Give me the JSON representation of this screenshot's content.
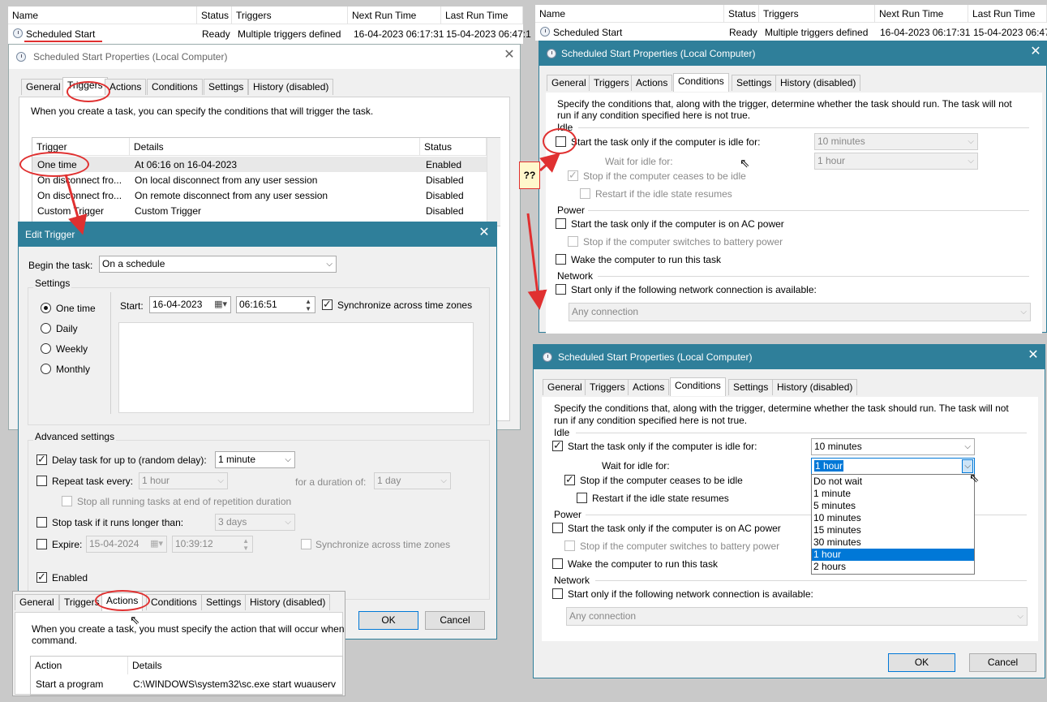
{
  "tasklist_header": {
    "name": "Name",
    "status": "Status",
    "triggers": "Triggers",
    "next_run": "Next Run Time",
    "last_run": "Last Run Time"
  },
  "task_row": {
    "name": "Scheduled Start",
    "status": "Ready",
    "triggers": "Multiple triggers defined",
    "next_run": "16-04-2023 06:17:31",
    "last_run_left": "15-04-2023 06:47:1",
    "last_run_right": "15-04-2023 06:47"
  },
  "props_title": "Scheduled Start Properties (Local Computer)",
  "tabs": [
    "General",
    "Triggers",
    "Actions",
    "Conditions",
    "Settings",
    "History (disabled)"
  ],
  "triggers_tab": {
    "intro": "When you create a task, you can specify the conditions that will trigger the task.",
    "columns": [
      "Trigger",
      "Details",
      "Status"
    ],
    "rows": [
      {
        "trigger": "One time",
        "details": "At 06:16 on 16-04-2023",
        "status": "Enabled"
      },
      {
        "trigger": "On disconnect fro...",
        "details": "On local disconnect from any user session",
        "status": "Disabled"
      },
      {
        "trigger": "On disconnect fro...",
        "details": "On remote disconnect from any user session",
        "status": "Disabled"
      },
      {
        "trigger": "Custom Trigger",
        "details": "Custom Trigger",
        "status": "Disabled"
      }
    ]
  },
  "edit_trigger": {
    "title": "Edit Trigger",
    "begin_label": "Begin the task:",
    "begin_value": "On a schedule",
    "settings_label": "Settings",
    "radios": [
      "One time",
      "Daily",
      "Weekly",
      "Monthly"
    ],
    "start_label": "Start:",
    "start_date": "16-04-2023",
    "start_time": "06:16:51",
    "sync_label": "Synchronize across time zones",
    "advanced_label": "Advanced settings",
    "delay_label": "Delay task for up to (random delay):",
    "delay_value": "1 minute",
    "repeat_label": "Repeat task every:",
    "repeat_value": "1 hour",
    "duration_label": "for a duration of:",
    "duration_value": "1 day",
    "stop_all_label": "Stop all running tasks at end of repetition duration",
    "stop_longer_label": "Stop task if it runs longer than:",
    "stop_longer_value": "3 days",
    "expire_label": "Expire:",
    "expire_date": "15-04-2024",
    "expire_time": "10:39:12",
    "expire_sync_label": "Synchronize across time zones",
    "enabled_label": "Enabled",
    "ok": "OK",
    "cancel": "Cancel"
  },
  "actions_tab": {
    "intro_line1": "When you create a task, you must specify the action that will occur when",
    "intro_line2": "command.",
    "columns": [
      "Action",
      "Details"
    ],
    "row": {
      "action": "Start a program",
      "details": "C:\\WINDOWS\\system32\\sc.exe start wuauserv"
    }
  },
  "annotation_q": "??",
  "conditions": {
    "intro_line1": "Specify the conditions that, along with the trigger, determine whether the task should run.  The task will not",
    "intro_line2": "run  if any condition specified here is not true.",
    "idle_label": "Idle",
    "idle_start_label": "Start the task only if the computer is idle for:",
    "idle_for_value": "10 minutes",
    "wait_label": "Wait for idle for:",
    "wait_value": "1 hour",
    "stop_idle_label": "Stop if the computer ceases to be idle",
    "restart_label": "Restart if the idle state resumes",
    "power_label": "Power",
    "ac_label": "Start the task only if the computer is on AC power",
    "battery_label": "Stop if the computer switches to battery power",
    "wake_label": "Wake the computer to run this task",
    "network_label": "Network",
    "network_start_label": "Start only if the following network connection is available:",
    "network_value": "Any connection",
    "dropdown_options": [
      "Do not wait",
      "1 minute",
      "5 minutes",
      "10 minutes",
      "15 minutes",
      "30 minutes",
      "1 hour",
      "2 hours"
    ],
    "dropdown_selected": "1 hour",
    "ok": "OK",
    "cancel": "Cancel"
  },
  "colors": {
    "title_teal": "#2f7f9a",
    "annotation_red": "#e03030",
    "selection_blue": "#0078d7"
  }
}
